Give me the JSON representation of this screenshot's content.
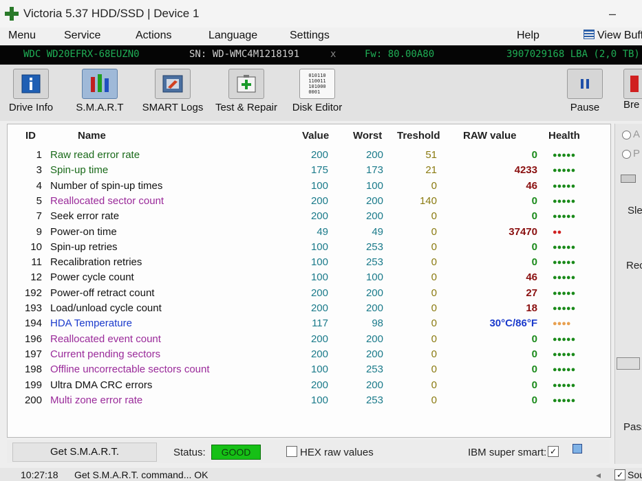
{
  "window": {
    "title": "Victoria 5.37 HDD/SSD | Device 1"
  },
  "menu": {
    "items": [
      "Menu",
      "Service",
      "Actions",
      "Language",
      "Settings",
      "Help"
    ],
    "view_buffer": "View Buffe"
  },
  "device": {
    "model": "WDC WD20EFRX-68EUZN0",
    "serial": "SN: WD-WMC4M1218191",
    "close": "x",
    "firmware": "Fw: 80.00A80",
    "capacity": "3907029168 LBA (2,0 TB)"
  },
  "toolbar": {
    "buttons": [
      {
        "label": "Drive Info",
        "icon": "info-icon"
      },
      {
        "label": "S.M.A.R.T",
        "icon": "smart-bars-icon"
      },
      {
        "label": "SMART Logs",
        "icon": "log-icon"
      },
      {
        "label": "Test & Repair",
        "icon": "first-aid-icon"
      },
      {
        "label": "Disk Editor",
        "icon": "binary-icon"
      }
    ],
    "pause": "Pause",
    "break": "Bre",
    "binary_text": [
      "010110",
      "110011",
      "101000",
      "0001"
    ]
  },
  "table": {
    "headers": {
      "id": "ID",
      "name": "Name",
      "value": "Value",
      "worst": "Worst",
      "threshold": "Treshold",
      "raw": "RAW value",
      "health": "Health"
    },
    "rows": [
      {
        "id": "1",
        "name": "Raw read error rate",
        "value": "200",
        "worst": "200",
        "threshold": "51",
        "raw": "0",
        "health": "●●●●●"
      },
      {
        "id": "3",
        "name": "Spin-up time",
        "value": "175",
        "worst": "173",
        "threshold": "21",
        "raw": "4233",
        "health": "●●●●●"
      },
      {
        "id": "4",
        "name": "Number of spin-up times",
        "value": "100",
        "worst": "100",
        "threshold": "0",
        "raw": "46",
        "health": "●●●●●"
      },
      {
        "id": "5",
        "name": "Reallocated sector count",
        "value": "200",
        "worst": "200",
        "threshold": "140",
        "raw": "0",
        "health": "●●●●●"
      },
      {
        "id": "7",
        "name": "Seek error rate",
        "value": "200",
        "worst": "200",
        "threshold": "0",
        "raw": "0",
        "health": "●●●●●"
      },
      {
        "id": "9",
        "name": "Power-on time",
        "value": "49",
        "worst": "49",
        "threshold": "0",
        "raw": "37470",
        "health": "●●"
      },
      {
        "id": "10",
        "name": "Spin-up retries",
        "value": "100",
        "worst": "253",
        "threshold": "0",
        "raw": "0",
        "health": "●●●●●"
      },
      {
        "id": "11",
        "name": "Recalibration retries",
        "value": "100",
        "worst": "253",
        "threshold": "0",
        "raw": "0",
        "health": "●●●●●"
      },
      {
        "id": "12",
        "name": "Power cycle count",
        "value": "100",
        "worst": "100",
        "threshold": "0",
        "raw": "46",
        "health": "●●●●●"
      },
      {
        "id": "192",
        "name": "Power-off retract count",
        "value": "200",
        "worst": "200",
        "threshold": "0",
        "raw": "27",
        "health": "●●●●●"
      },
      {
        "id": "193",
        "name": "Load/unload cycle count",
        "value": "200",
        "worst": "200",
        "threshold": "0",
        "raw": "18",
        "health": "●●●●●"
      },
      {
        "id": "194",
        "name": "HDA Temperature",
        "value": "117",
        "worst": "98",
        "threshold": "0",
        "raw": "30°C/86°F",
        "health": "●●●●"
      },
      {
        "id": "196",
        "name": "Reallocated event count",
        "value": "200",
        "worst": "200",
        "threshold": "0",
        "raw": "0",
        "health": "●●●●●"
      },
      {
        "id": "197",
        "name": "Current pending sectors",
        "value": "200",
        "worst": "200",
        "threshold": "0",
        "raw": "0",
        "health": "●●●●●"
      },
      {
        "id": "198",
        "name": "Offline uncorrectable sectors count",
        "value": "100",
        "worst": "253",
        "threshold": "0",
        "raw": "0",
        "health": "●●●●●"
      },
      {
        "id": "199",
        "name": "Ultra DMA CRC errors",
        "value": "200",
        "worst": "200",
        "threshold": "0",
        "raw": "0",
        "health": "●●●●●"
      },
      {
        "id": "200",
        "name": "Multi zone error rate",
        "value": "100",
        "worst": "253",
        "threshold": "0",
        "raw": "0",
        "health": "●●●●●"
      }
    ]
  },
  "colors": {
    "critical_name": "#9a2a9a",
    "normal_name": "#111111",
    "temp_name": "#1a3acc",
    "raw_zero": "#1a8a1a",
    "raw_nonzero": "#8a1010",
    "health_good": "#1a8a1a",
    "health_warn": "#d02020",
    "health_temp": "#e8a050",
    "status_good": "#16c016"
  },
  "footer": {
    "get_smart": "Get S.M.A.R.T.",
    "status_label": "Status:",
    "status_value": "GOOD",
    "hex_raw": "HEX raw values",
    "ibm_super_smart": "IBM super smart:",
    "ibm_check": "✓"
  },
  "statusbar": {
    "time": "10:27:18",
    "message": "Get S.M.A.R.T. command... OK",
    "sound": "Sou",
    "sound_check": "✓"
  },
  "right_panel": {
    "a": "A",
    "p": "P",
    "sle": "Sle",
    "rec": "Rec",
    "pass": "Pass"
  }
}
